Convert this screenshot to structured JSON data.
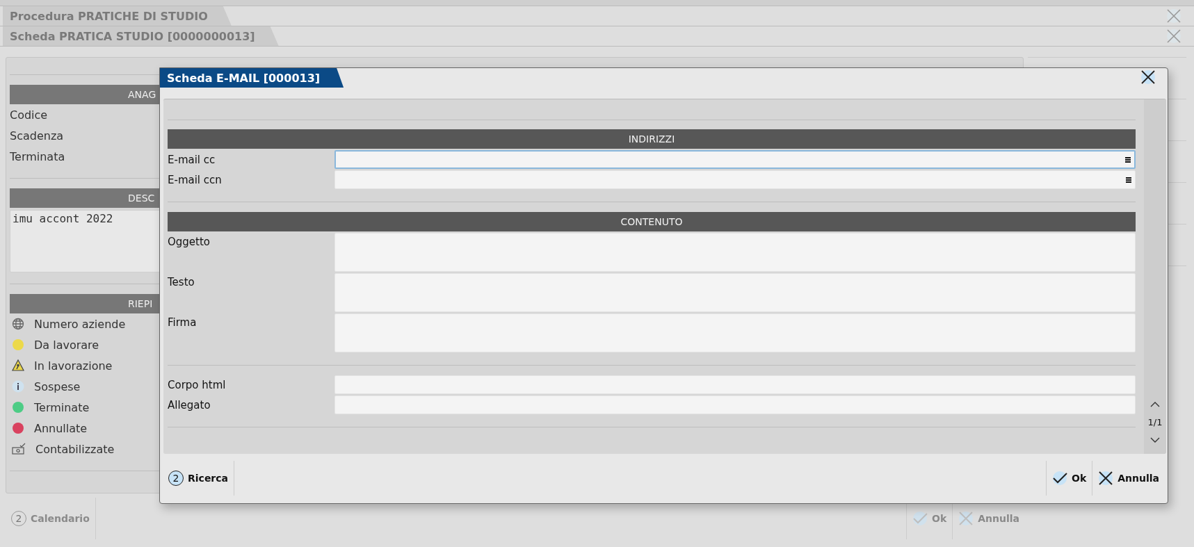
{
  "window": {
    "tabs": [
      {
        "title": "Procedura PRATICHE DI STUDIO"
      },
      {
        "title": "Scheda PRATICA STUDIO [0000000013]"
      }
    ]
  },
  "form": {
    "sections": [
      {
        "title": "ANAG",
        "kind": "fields",
        "fields": [
          "Codice",
          "Scadenza",
          "Terminata"
        ]
      },
      {
        "title": "DESC",
        "kind": "text",
        "text": "imu accont 2022"
      },
      {
        "title": "RIEPI",
        "kind": "legend",
        "items": [
          {
            "label": "Numero aziende",
            "kind": "globe"
          },
          {
            "label": "Da lavorare",
            "kind": "dot",
            "color": "#ecd94a"
          },
          {
            "label": "In lavorazione",
            "kind": "warning"
          },
          {
            "label": "Sospese",
            "kind": "info"
          },
          {
            "label": "Terminate",
            "kind": "dot",
            "color": "#4dcc85"
          },
          {
            "label": "Annullate",
            "kind": "dot",
            "color": "#d9425f"
          },
          {
            "label": "Contabilizzate",
            "kind": "register"
          }
        ]
      }
    ]
  },
  "toolbar": {
    "left": [
      {
        "label": "Calendario",
        "kind": "key",
        "key": "2",
        "disabled": true
      }
    ],
    "right": [
      {
        "label": "Ok",
        "kind": "ok",
        "disabled": true
      },
      {
        "label": "Annulla",
        "kind": "cancel",
        "disabled": true
      }
    ]
  },
  "dialog": {
    "title": "Scheda E-MAIL [000013]",
    "sections": [
      {
        "title": "INDIRIZZI",
        "fields": [
          {
            "label": "E-mail cc",
            "kind": "line",
            "menu": true,
            "focused": true
          },
          {
            "label": "E-mail ccn",
            "kind": "line",
            "menu": true,
            "focused": false
          }
        ]
      },
      {
        "title": "CONTENUTO",
        "fields": [
          {
            "label": "Oggetto",
            "kind": "multiline",
            "focused": false
          },
          {
            "label": "Testo",
            "kind": "multiline",
            "focused": false
          },
          {
            "label": "Firma",
            "kind": "multiline",
            "focused": false
          }
        ]
      },
      {
        "fields": [
          {
            "label": "Corpo html",
            "kind": "line",
            "focused": false
          },
          {
            "label": "Allegato",
            "kind": "line",
            "focused": false
          }
        ]
      }
    ],
    "pager": "1/1",
    "toolbar": {
      "left": [
        {
          "label": "Ricerca",
          "kind": "key",
          "key": "2",
          "disabled": false
        }
      ],
      "right": [
        {
          "label": "Ok",
          "kind": "ok",
          "disabled": false
        },
        {
          "label": "Annulla",
          "kind": "cancel",
          "disabled": false
        }
      ]
    }
  }
}
